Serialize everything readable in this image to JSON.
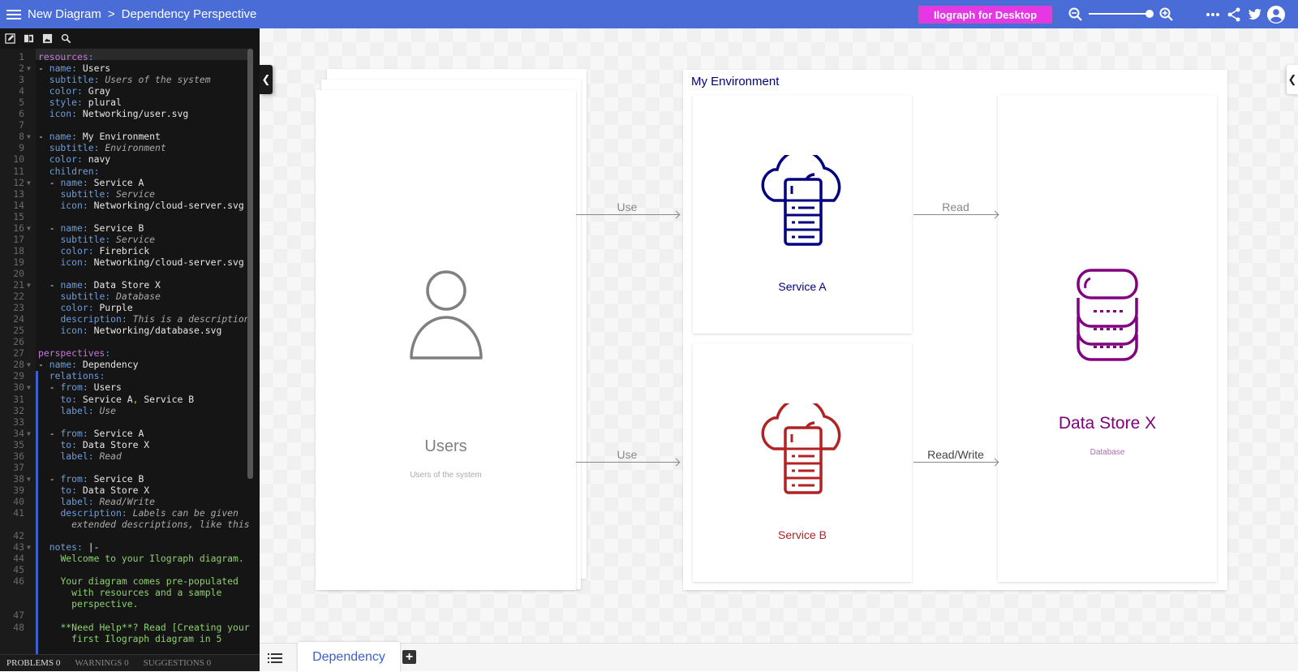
{
  "header": {
    "diagram_name": "New Diagram",
    "separator": ">",
    "perspective_name": "Dependency Perspective",
    "desktop_button": "Ilograph for Desktop",
    "zoom_level": 1.0
  },
  "editor": {
    "toolbar_icons": [
      "edit-icon",
      "book-icon",
      "image-icon",
      "search-icon"
    ],
    "lines": [
      {
        "n": "1",
        "html": "<span class='kw'>resources</span><span class='p'>:</span>"
      },
      {
        "n": "2",
        "f": true,
        "html": "<span class='v'>-</span> <span class='k'>name</span><span class='p'>:</span> <span class='v'>Users</span>"
      },
      {
        "n": "3",
        "html": "  <span class='k'>subtitle</span><span class='p'>:</span> <span class='it'>Users of the system</span>"
      },
      {
        "n": "4",
        "html": "  <span class='k'>color</span><span class='p'>:</span> <span class='v'>Gray</span>"
      },
      {
        "n": "5",
        "html": "  <span class='k'>style</span><span class='p'>:</span> <span class='v'>plural</span>"
      },
      {
        "n": "6",
        "html": "  <span class='k'>icon</span><span class='p'>:</span> <span class='v'>Networking/user.svg</span>"
      },
      {
        "n": "7",
        "html": ""
      },
      {
        "n": "8",
        "f": true,
        "html": "<span class='v'>-</span> <span class='k'>name</span><span class='p'>:</span> <span class='v'>My Environment</span>"
      },
      {
        "n": "9",
        "html": "  <span class='k'>subtitle</span><span class='p'>:</span> <span class='it'>Environment</span>"
      },
      {
        "n": "10",
        "html": "  <span class='k'>color</span><span class='p'>:</span> <span class='v'>navy</span>"
      },
      {
        "n": "11",
        "html": "  <span class='k'>children</span><span class='p'>:</span>"
      },
      {
        "n": "12",
        "f": true,
        "html": "  <span class='v'>-</span> <span class='k'>name</span><span class='p'>:</span> <span class='v'>Service A</span>"
      },
      {
        "n": "13",
        "html": "    <span class='k'>subtitle</span><span class='p'>:</span> <span class='it'>Service</span>"
      },
      {
        "n": "14",
        "html": "    <span class='k'>icon</span><span class='p'>:</span> <span class='v'>Networking/cloud-server.svg</span>"
      },
      {
        "n": "15",
        "html": ""
      },
      {
        "n": "16",
        "f": true,
        "html": "  <span class='v'>-</span> <span class='k'>name</span><span class='p'>:</span> <span class='v'>Service B</span>"
      },
      {
        "n": "17",
        "html": "    <span class='k'>subtitle</span><span class='p'>:</span> <span class='it'>Service</span>"
      },
      {
        "n": "18",
        "html": "    <span class='k'>color</span><span class='p'>:</span> <span class='v'>Firebrick</span>"
      },
      {
        "n": "19",
        "html": "    <span class='k'>icon</span><span class='p'>:</span> <span class='v'>Networking/cloud-server.svg</span>"
      },
      {
        "n": "20",
        "html": ""
      },
      {
        "n": "21",
        "f": true,
        "html": "  <span class='v'>-</span> <span class='k'>name</span><span class='p'>:</span> <span class='v'>Data Store X</span>"
      },
      {
        "n": "22",
        "html": "    <span class='k'>subtitle</span><span class='p'>:</span> <span class='it'>Database</span>"
      },
      {
        "n": "23",
        "html": "    <span class='k'>color</span><span class='p'>:</span> <span class='v'>Purple</span>"
      },
      {
        "n": "24",
        "html": "    <span class='k'>description</span><span class='p'>:</span> <span class='it'>This is a description</span>"
      },
      {
        "n": "25",
        "html": "    <span class='k'>icon</span><span class='p'>:</span> <span class='v'>Networking/database.svg</span>"
      },
      {
        "n": "26",
        "html": ""
      },
      {
        "n": "27",
        "html": "<span class='kw'>perspectives</span><span class='p'>:</span>"
      },
      {
        "n": "28",
        "f": true,
        "html": "<span class='v'>-</span> <span class='k'>name</span><span class='p'>:</span> <span class='v'>Dependency</span>"
      },
      {
        "n": "29",
        "html": "  <span class='k'>relations</span><span class='p'>:</span>"
      },
      {
        "n": "30",
        "f": true,
        "html": "  <span class='v'>-</span> <span class='k'>from</span><span class='p'>:</span> <span class='v'>Users</span>"
      },
      {
        "n": "31",
        "html": "    <span class='k'>to</span><span class='p'>:</span> <span class='v'>Service A</span><span class='g'>,</span> <span class='v'>Service B</span>"
      },
      {
        "n": "32",
        "html": "    <span class='k'>label</span><span class='p'>:</span> <span class='it'>Use</span>"
      },
      {
        "n": "33",
        "html": ""
      },
      {
        "n": "34",
        "f": true,
        "html": "  <span class='v'>-</span> <span class='k'>from</span><span class='p'>:</span> <span class='v'>Service A</span>"
      },
      {
        "n": "35",
        "html": "    <span class='k'>to</span><span class='p'>:</span> <span class='v'>Data Store X</span>"
      },
      {
        "n": "36",
        "html": "    <span class='k'>label</span><span class='p'>:</span> <span class='it'>Read</span>"
      },
      {
        "n": "37",
        "html": ""
      },
      {
        "n": "38",
        "f": true,
        "html": "  <span class='v'>-</span> <span class='k'>from</span><span class='p'>:</span> <span class='v'>Service B</span>"
      },
      {
        "n": "39",
        "html": "    <span class='k'>to</span><span class='p'>:</span> <span class='v'>Data Store X</span>"
      },
      {
        "n": "40",
        "html": "    <span class='k'>label</span><span class='p'>:</span> <span class='it'>Read/Write</span>"
      },
      {
        "n": "41",
        "html": "    <span class='k'>description</span><span class='p'>:</span> <span class='it'>Labels can be given</span>"
      },
      {
        "n": "",
        "html": "      <span class='it'>extended descriptions, like this</span>"
      },
      {
        "n": "42",
        "html": ""
      },
      {
        "n": "43",
        "f": true,
        "html": "  <span class='k'>notes</span><span class='p'>:</span> <span class='v'>|-</span>"
      },
      {
        "n": "44",
        "html": "    <span class='g'>Welcome to your Ilograph diagram.</span>"
      },
      {
        "n": "45",
        "html": ""
      },
      {
        "n": "46",
        "html": "    <span class='g'>Your diagram comes pre-populated</span>"
      },
      {
        "n": "",
        "html": "      <span class='g'>with resources and a sample</span>"
      },
      {
        "n": "",
        "html": "      <span class='g'>perspective.</span>"
      },
      {
        "n": "47",
        "html": ""
      },
      {
        "n": "48",
        "html": "    <span class='g'>**Need Help**? Read [Creating your</span>"
      },
      {
        "n": "",
        "html": "      <span class='g'>first Ilograph diagram in 5</span>"
      }
    ],
    "status": {
      "problems": "PROBLEMS 0",
      "warnings": "WARNINGS 0",
      "suggestions": "SUGGESTIONS 0"
    }
  },
  "diagram": {
    "users": {
      "name": "Users",
      "subtitle": "Users of the system",
      "color": "#808080"
    },
    "environment": {
      "name": "My Environment",
      "color": "#000080"
    },
    "service_a": {
      "name": "Service A",
      "color": "#000080"
    },
    "service_b": {
      "name": "Service B",
      "color": "#b22222"
    },
    "data_store": {
      "name": "Data Store X",
      "subtitle": "Database",
      "color": "#800080",
      "subtitle_color": "#b06ab0"
    },
    "relations": [
      {
        "from": "Users",
        "to": "Service A",
        "label": "Use"
      },
      {
        "from": "Users",
        "to": "Service B",
        "label": "Use"
      },
      {
        "from": "Service A",
        "to": "Data Store X",
        "label": "Read"
      },
      {
        "from": "Service B",
        "to": "Data Store X",
        "label": "Read/Write"
      }
    ]
  },
  "bottom": {
    "tab_label": "Dependency",
    "add_label": "+"
  },
  "colors": {
    "header": "#4a6cd7",
    "desktop_button": "#e636e6"
  }
}
